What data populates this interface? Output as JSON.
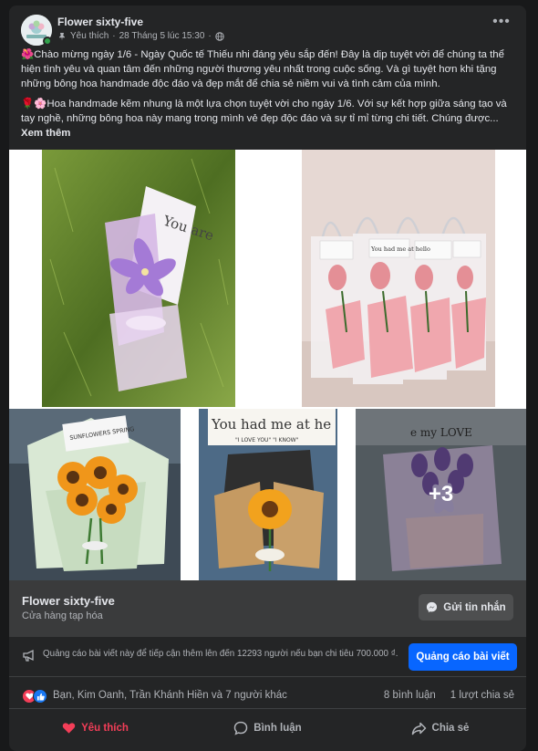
{
  "post": {
    "page_name": "Flower sixty-five",
    "meta_label": "Yêu thích",
    "separator": "·",
    "timestamp": "28 Tháng 5 lúc 15:30",
    "separator2": "·",
    "paragraph1": "🌺Chào mừng ngày 1/6 - Ngày Quốc tế Thiếu nhi đáng yêu sắp đến! Đây là dịp tuyệt vời để chúng ta thể hiện tình yêu và quan tâm đến những người thương yêu nhất trong cuộc sống. Và gì tuyệt hơn khi tặng những bông hoa handmade độc đáo và đẹp mắt để chia sẻ niềm vui và tình cảm của mình.",
    "paragraph2": "🌹🌸Hoa handmade kẽm nhung là một lựa chọn tuyệt vời cho ngày 1/6. Với sự kết hợp giữa sáng tạo và tay nghề, những bông hoa này mang trong mình vẻ đẹp độc đáo và sự tỉ mỉ từng chi tiết. Chúng được...",
    "see_more": "Xem thêm"
  },
  "photos": {
    "photo1_card_text": "You are",
    "photo2_card_text": "You had me at hello",
    "photo3_card_text": "SUNFLOWERS SPRING",
    "photo4_card_text": "You had me at he",
    "photo4_sub_text": "\"I LOVE YOU\"  \"I KNOW\"",
    "photo5_card_text": "e my LOVE",
    "more_count": "+3"
  },
  "shop": {
    "name": "Flower sixty-five",
    "category": "Cửa hàng tạp hóa",
    "message_button": "Gửi tin nhắn"
  },
  "boost": {
    "text": "Quảng cáo bài viết này để tiếp cận thêm lên đến 12293 người nếu bạn chi tiêu 700.000 ₫.",
    "button": "Quảng cáo bài viết"
  },
  "reactions": {
    "names": "Bạn, Kim Oanh, Trần Khánh Hiền và 7 người khác",
    "comments": "8 bình luận",
    "shares": "1 lượt chia sẻ"
  },
  "actions": {
    "like": "Yêu thích",
    "comment": "Bình luận",
    "share": "Chia sẻ"
  },
  "colors": {
    "card_bg": "#242526",
    "accent_blue": "#0866ff",
    "love_red": "#f33e58"
  }
}
